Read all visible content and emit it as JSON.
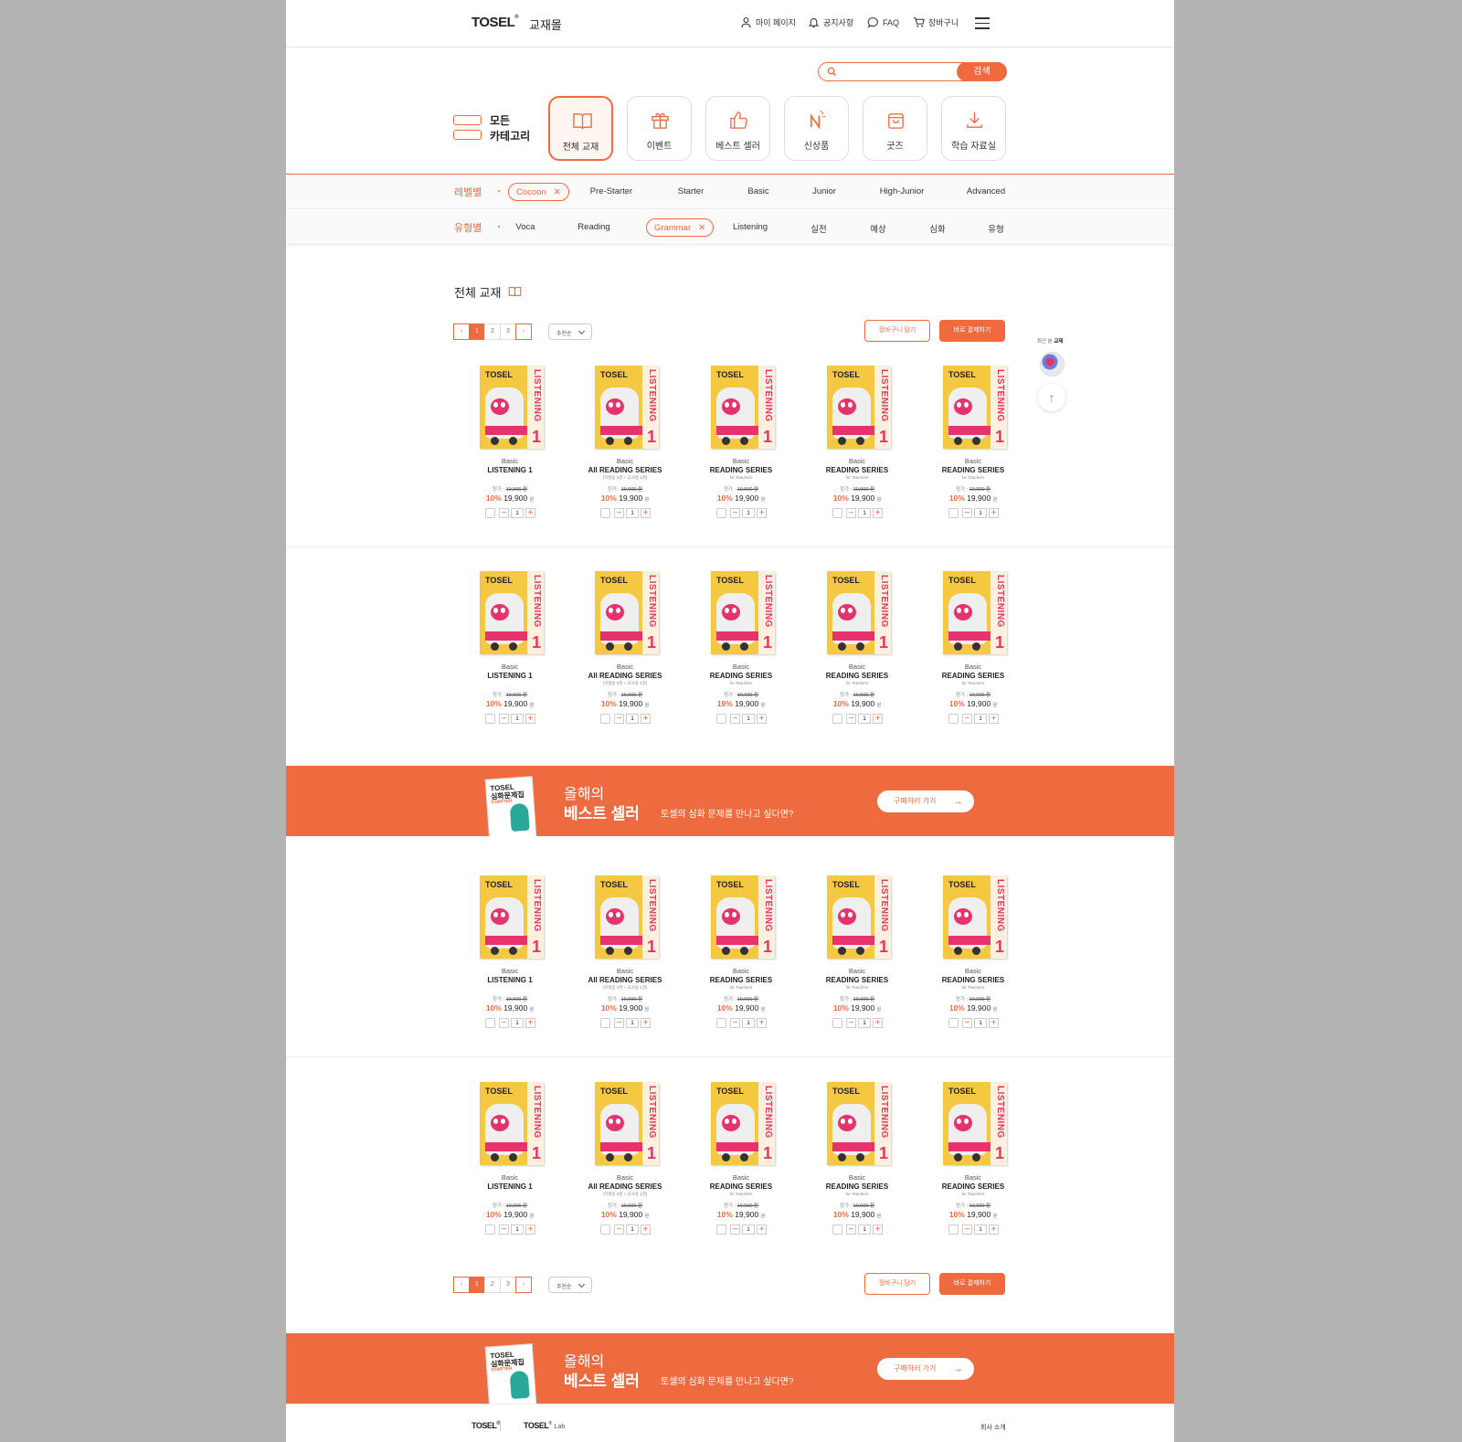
{
  "header": {
    "logo": "TOSEL",
    "mall": "교재몰",
    "nav": [
      {
        "icon": "person-icon",
        "label": "마이 페이지"
      },
      {
        "icon": "bell-icon",
        "label": "공지사항"
      },
      {
        "icon": "chat-icon",
        "label": "FAQ"
      },
      {
        "icon": "cart-icon",
        "label": "장바구니"
      }
    ]
  },
  "search": {
    "placeholder": "",
    "button": "검색"
  },
  "categories": {
    "all_label_1": "모든",
    "all_label_2": "카테고리",
    "tiles": [
      {
        "icon": "book-icon",
        "label": "전체 교재",
        "active": true
      },
      {
        "icon": "gift-icon",
        "label": "이벤트"
      },
      {
        "icon": "thumbs-up-icon",
        "label": "베스트 셀러"
      },
      {
        "icon": "new-icon",
        "label": "신상품"
      },
      {
        "icon": "bag-icon",
        "label": "굿즈"
      },
      {
        "icon": "download-icon",
        "label": "학습 자료실"
      }
    ]
  },
  "filters": {
    "level_title": "레벨별",
    "level_selected": "Cocoon",
    "levels": [
      "Pre-Starter",
      "Starter",
      "Basic",
      "Junior",
      "High-Junior",
      "Advanced"
    ],
    "type_title": "유형별",
    "type_selected": "Grammar",
    "types_before": [
      "Voca",
      "Reading"
    ],
    "types_after": [
      "Listening",
      "실전",
      "예상",
      "심화",
      "유형"
    ]
  },
  "section": {
    "title": "전체 교재"
  },
  "pager": {
    "pages": [
      "1",
      "2",
      "3"
    ],
    "current": "1",
    "sort": "추천순"
  },
  "actions": {
    "cart": "장바구니 담기",
    "buy": "바로 결제하기"
  },
  "products": [
    {
      "level": "Basic",
      "title": "LISTENING 1",
      "sub": "",
      "list_label": "정가 :",
      "list_price": "19,900 원",
      "discount": "10%",
      "price": "19,900",
      "won": "원",
      "qty": "1",
      "cover_logo": "TOSEL",
      "cover_spine": "LISTENING",
      "cover_num": "1"
    },
    {
      "level": "Basic",
      "title": "All READING SERIES",
      "sub": "(학생용 3권 + 교사용 1권)",
      "list_label": "정가 :",
      "list_price": "19,900 원",
      "discount": "10%",
      "price": "19,900",
      "won": "원",
      "qty": "1",
      "cover_logo": "TOSEL",
      "cover_spine": "LISTENING",
      "cover_num": "1"
    },
    {
      "level": "Basic",
      "title": "READING SERIES",
      "sub": "for Teachers",
      "list_label": "정가 :",
      "list_price": "19,900 원",
      "discount": "10%",
      "price": "19,900",
      "won": "원",
      "qty": "1",
      "cover_logo": "TOSEL",
      "cover_spine": "LISTENING",
      "cover_num": "1"
    },
    {
      "level": "Basic",
      "title": "READING SERIES",
      "sub": "for Teachers",
      "list_label": "정가 :",
      "list_price": "19,900 원",
      "discount": "10%",
      "price": "19,900",
      "won": "원",
      "qty": "1",
      "cover_logo": "TOSEL",
      "cover_spine": "LISTENING",
      "cover_num": "1"
    },
    {
      "level": "Basic",
      "title": "READING SERIES",
      "sub": "for Teachers",
      "list_label": "정가 :",
      "list_price": "19,900 원",
      "discount": "10%",
      "price": "19,900",
      "won": "원",
      "qty": "1",
      "cover_logo": "TOSEL",
      "cover_spine": "LISTENING",
      "cover_num": "1"
    }
  ],
  "banner": {
    "book_logo": "TOSEL",
    "book_title": "심화문제집",
    "book_level": "STARTER",
    "line1": "올해의",
    "line2": "베스트 셀러",
    "text": "토셀의 심화 문제를 만나고 싶다면?",
    "button": "구매하러 가기"
  },
  "side": {
    "recent_prefix": "최근 본",
    "recent_bold": "교재",
    "top": "↑"
  },
  "footer": {
    "logo1": "TOSEL",
    "logo2": "TOSEL",
    "lab": "Lab",
    "about": "회사 소개"
  },
  "colors": {
    "accent": "#ef6a3f",
    "cover": "#f5c842",
    "spine": "#e7336b"
  }
}
